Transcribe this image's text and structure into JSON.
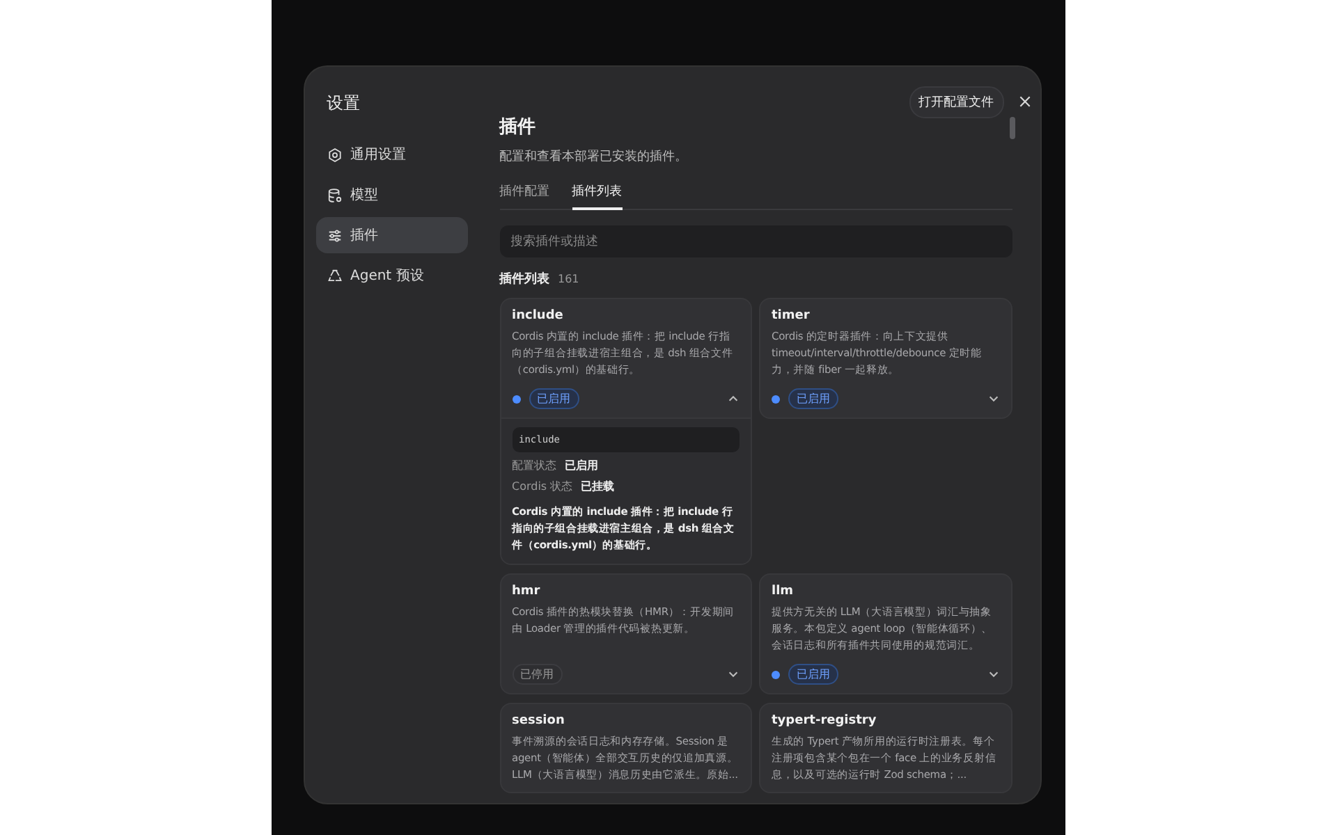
{
  "dialog": {
    "title": "设置",
    "open_config_button": "打开配置文件"
  },
  "sidebar": {
    "items": [
      {
        "label": "通用设置",
        "selected": false
      },
      {
        "label": "模型",
        "selected": false
      },
      {
        "label": "插件",
        "selected": true
      },
      {
        "label": "Agent 预设",
        "selected": false
      }
    ]
  },
  "page": {
    "title": "插件",
    "subtitle": "配置和查看本部署已安装的插件。"
  },
  "tabs": [
    {
      "label": "插件配置",
      "selected": false
    },
    {
      "label": "插件列表",
      "selected": true
    }
  ],
  "search": {
    "placeholder": "搜索插件或描述"
  },
  "list": {
    "title": "插件列表",
    "count": "161"
  },
  "plugins": [
    {
      "name": "include",
      "description": "Cordis 内置的 include 插件：把 include 行指向的子组合挂载进宿主组合，是 dsh 组合文件（cordis.yml）的基础行。",
      "enabled": true,
      "status": "已启用",
      "expanded": true,
      "details": {
        "id": "include",
        "rows": [
          {
            "label": "配置状态",
            "value": "已启用"
          },
          {
            "label": "Cordis 状态",
            "value": "已挂载"
          }
        ],
        "description": "Cordis 内置的 include 插件：把 include 行指向的子组合挂载进宿主组合，是 dsh 组合文件（cordis.yml）的基础行。"
      }
    },
    {
      "name": "timer",
      "description": "Cordis 的定时器插件：向上下文提供 timeout/interval/throttle/debounce 定时能力，并随 fiber 一起释放。",
      "enabled": true,
      "status": "已启用",
      "expanded": false
    },
    {
      "name": "hmr",
      "description": "Cordis 插件的热模块替换（HMR）：开发期间由 Loader 管理的插件代码被热更新。",
      "enabled": false,
      "status": "已停用",
      "expanded": false
    },
    {
      "name": "llm",
      "description": "提供方无关的 LLM（大语言模型）词汇与抽象服务。本包定义 agent loop（智能体循环）、会话日志和所有插件共同使用的规范词汇。",
      "enabled": true,
      "status": "已启用",
      "expanded": false
    },
    {
      "name": "session",
      "description": "事件溯源的会话日志和内存存储。Session 是 agent（智能体）全部交互历史的仅追加真源。LLM（大语言模型）消息历史由它派生。原始..."
    },
    {
      "name": "typert-registry",
      "description": "生成的 Typert 产物所用的运行时注册表。每个注册项包含某个包在一个 face 上的业务反射信息，以及可选的运行时 Zod schema；..."
    }
  ]
}
